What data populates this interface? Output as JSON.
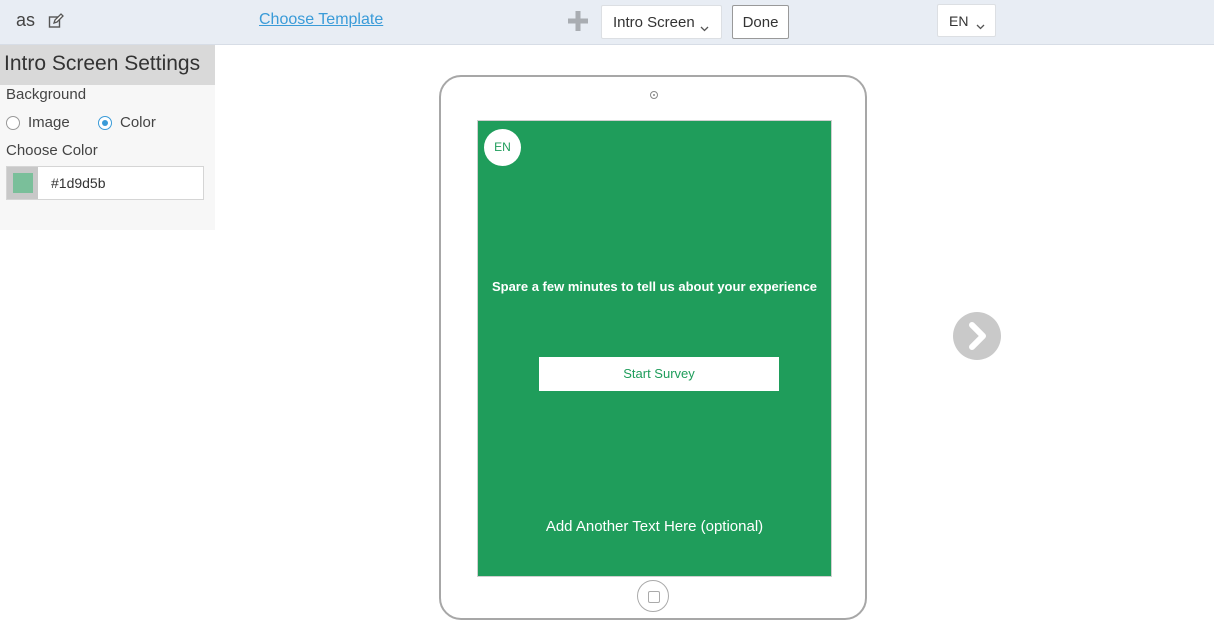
{
  "header": {
    "survey_name": "as",
    "choose_template": "Choose Template",
    "screen_select": "Intro Screen",
    "done": "Done",
    "language": "EN"
  },
  "settings": {
    "title": "Intro Screen Settings",
    "background_label": "Background",
    "options": {
      "image": "Image",
      "color": "Color"
    },
    "selected_option": "Color",
    "choose_color_label": "Choose Color",
    "color_value": "#1d9d5b"
  },
  "preview": {
    "language_badge": "EN",
    "intro_text": "Spare a few minutes to tell us about your experience",
    "start_button": "Start Survey",
    "another_text": "Add Another Text Here (optional)"
  },
  "colors": {
    "screen_background": "#1f9d5b",
    "swatch": "#7abf9a",
    "link": "#3a9bd8"
  }
}
